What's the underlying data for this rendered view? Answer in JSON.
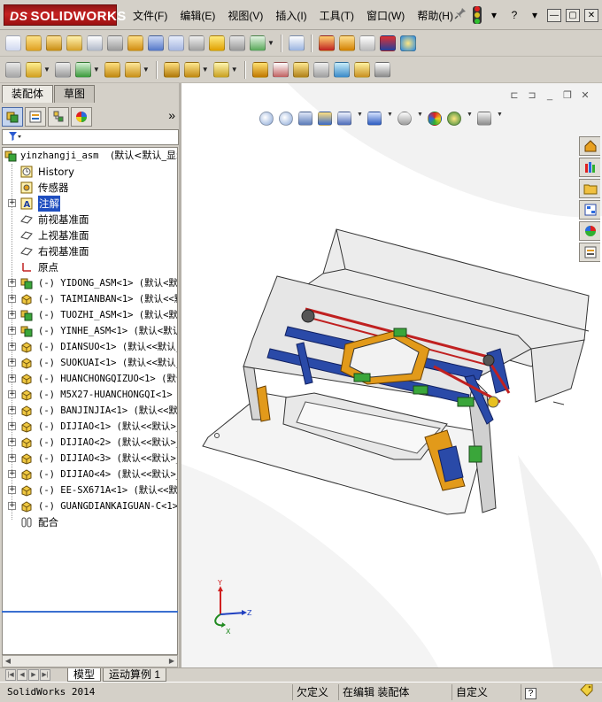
{
  "app": {
    "logo_text": "SOLIDWORKS",
    "logo_prefix": "DS"
  },
  "menu": [
    {
      "label": "文件(F)"
    },
    {
      "label": "编辑(E)"
    },
    {
      "label": "视图(V)"
    },
    {
      "label": "插入(I)"
    },
    {
      "label": "工具(T)"
    },
    {
      "label": "窗口(W)"
    },
    {
      "label": "帮助(H)"
    }
  ],
  "titlebar_right": {
    "help_symbol": "?",
    "dropdown_symbol": "▾",
    "minimize_symbol": "—",
    "restore_symbol": "▢",
    "close_symbol": "✕"
  },
  "left_panel": {
    "tabs": [
      {
        "label": "装配体",
        "active": true
      },
      {
        "label": "草图",
        "active": false
      }
    ],
    "more_symbol": "»"
  },
  "tree": {
    "root": "yinzhangji_asm",
    "root_config": "(默认<默认_显示",
    "items": [
      {
        "label": "History",
        "icon": "history-icon",
        "expander": "",
        "kind": "cn"
      },
      {
        "label": "传感器",
        "icon": "sensor-icon",
        "expander": "",
        "kind": "cn"
      },
      {
        "label": "注解",
        "icon": "annotation-icon",
        "expander": "+",
        "kind": "cn",
        "selected": true
      },
      {
        "label": "前视基准面",
        "icon": "plane-icon",
        "expander": "",
        "kind": "cn"
      },
      {
        "label": "上视基准面",
        "icon": "plane-icon",
        "expander": "",
        "kind": "cn"
      },
      {
        "label": "右视基准面",
        "icon": "plane-icon",
        "expander": "",
        "kind": "cn"
      },
      {
        "label": "原点",
        "icon": "origin-icon",
        "expander": "",
        "kind": "cn"
      },
      {
        "label": "(-) YIDONG_ASM<1> (默认<默认",
        "icon": "subassembly-icon",
        "expander": "+",
        "kind": "mono"
      },
      {
        "label": "(-) TAIMIANBAN<1> (默认<<默",
        "icon": "part-icon",
        "expander": "+",
        "kind": "mono"
      },
      {
        "label": "(-) TUOZHI_ASM<1> (默认<默认",
        "icon": "subassembly-icon",
        "expander": "+",
        "kind": "mono"
      },
      {
        "label": "(-) YINHE_ASM<1> (默认<默认_",
        "icon": "subassembly-icon",
        "expander": "+",
        "kind": "mono"
      },
      {
        "label": "(-) DIANSUO<1> (默认<<默认_",
        "icon": "part-icon",
        "expander": "+",
        "kind": "mono"
      },
      {
        "label": "(-) SUOKUAI<1> (默认<<默认_",
        "icon": "part-icon",
        "expander": "+",
        "kind": "mono"
      },
      {
        "label": "(-) HUANCHONGQIZUO<1> (默认",
        "icon": "part-icon",
        "expander": "+",
        "kind": "mono"
      },
      {
        "label": "(-) M5X27-HUANCHONGQI<1> (",
        "icon": "part-icon",
        "expander": "+",
        "kind": "mono"
      },
      {
        "label": "(-) BANJINJIA<1> (默认<<默认",
        "icon": "part-icon",
        "expander": "+",
        "kind": "mono"
      },
      {
        "label": "(-) DIJIAO<1> (默认<<默认>_",
        "icon": "part-icon",
        "expander": "+",
        "kind": "mono"
      },
      {
        "label": "(-) DIJIAO<2> (默认<<默认>_",
        "icon": "part-icon",
        "expander": "+",
        "kind": "mono"
      },
      {
        "label": "(-) DIJIAO<3> (默认<<默认>_",
        "icon": "part-icon",
        "expander": "+",
        "kind": "mono"
      },
      {
        "label": "(-) DIJIAO<4> (默认<<默认>_",
        "icon": "part-icon",
        "expander": "+",
        "kind": "mono"
      },
      {
        "label": "(-) EE-SX671A<1> (默认<<默认",
        "icon": "part-icon",
        "expander": "+",
        "kind": "mono"
      },
      {
        "label": "(-) GUANGDIANKAIGUAN-C<1>",
        "icon": "part-icon",
        "expander": "+",
        "kind": "mono"
      },
      {
        "label": "配合",
        "icon": "mates-icon",
        "expander": "",
        "kind": "cn"
      }
    ]
  },
  "bottom_tabs": [
    {
      "label": "模型",
      "active": true
    },
    {
      "label": "运动算例 1",
      "active": false
    }
  ],
  "status": {
    "product": "SolidWorks 2014",
    "underdefined": "欠定义",
    "editing": "在编辑 装配体",
    "custom": "自定义",
    "help_symbol": "?"
  },
  "triad": {
    "x": "X",
    "y": "Y",
    "z": "Z"
  },
  "colors": {
    "logo_red": "#c62222",
    "selection_blue": "#1f4fc0",
    "frame_blue": "#2a4aa8",
    "belt_red": "#c02020",
    "bracket_orange": "#e29a1a",
    "sensor_green": "#3aa63a"
  }
}
